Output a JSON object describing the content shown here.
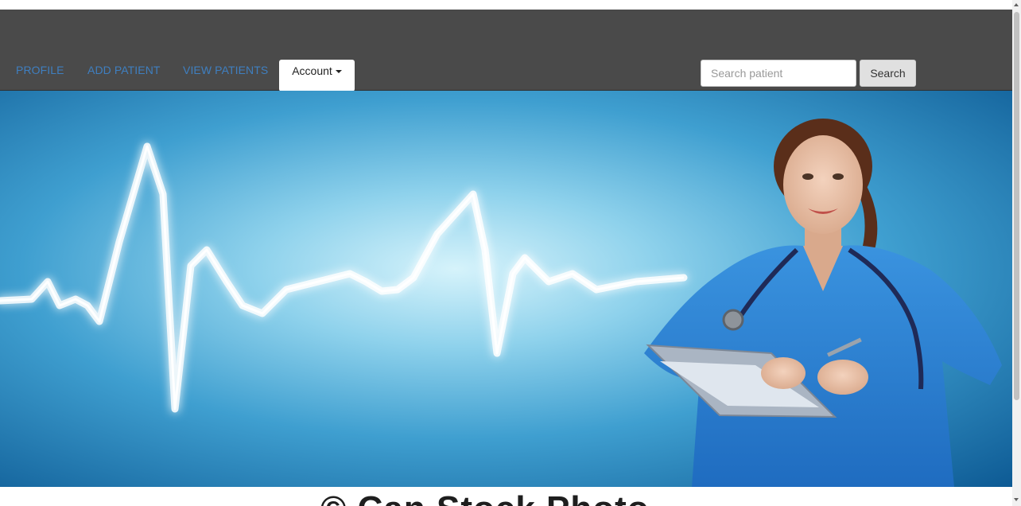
{
  "nav": {
    "links": [
      {
        "label": "PROFILE"
      },
      {
        "label": "ADD PATIENT"
      },
      {
        "label": "VIEW PATIENTS"
      }
    ],
    "account_label": "Account",
    "search": {
      "placeholder": "Search patient",
      "value": ""
    },
    "search_button": "Search"
  },
  "hero": {
    "watermark": "© Can Stock Photo"
  },
  "colors": {
    "navbar_bg": "#4a4a4a",
    "nav_link": "#3f7fc0",
    "scrub_blue": "#2f86d6"
  }
}
